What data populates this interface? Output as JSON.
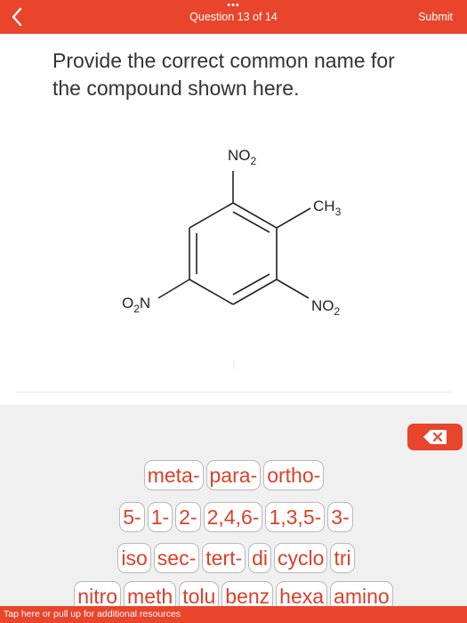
{
  "header": {
    "dots": "•••",
    "question_counter": "Question 13 of 14",
    "submit_label": "Submit"
  },
  "question": {
    "text": "Provide the correct common name for the compound shown here."
  },
  "structure": {
    "top_group": "NO",
    "top_group_sub": "2",
    "right_group": "CH",
    "right_group_sub": "3",
    "bottom_right_group": "NO",
    "bottom_right_group_sub": "2",
    "left_group": "O",
    "left_group_sub": "2",
    "left_group_tail": "N"
  },
  "keyboard": {
    "row1": [
      "meta-",
      "para-",
      "ortho-"
    ],
    "row2": [
      "5-",
      "1-",
      "2-",
      "2,4,6-",
      "1,3,5-",
      "3-"
    ],
    "row3": [
      "iso",
      "sec-",
      "tert-",
      "di",
      "cyclo",
      "tri"
    ],
    "row4": [
      "nitro",
      "meth",
      "tolu",
      "benz",
      "hexa",
      "amino"
    ]
  },
  "footer": {
    "text": "Tap here or pull up for additional resources"
  },
  "colors": {
    "accent": "#e8452c",
    "key_text": "#d9412a",
    "keyboard_bg": "#f0f0f0"
  }
}
